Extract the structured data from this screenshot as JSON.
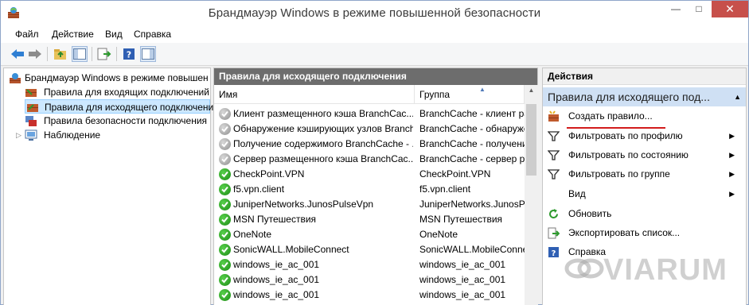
{
  "window": {
    "title": "Брандмауэр Windows в режиме повышенной безопасности"
  },
  "menu": [
    "Файл",
    "Действие",
    "Вид",
    "Справка"
  ],
  "tree": {
    "root": "Брандмауэр Windows в режиме повышен",
    "items": [
      "Правила для входящих подключений",
      "Правила для исходящего подключени",
      "Правила безопасности подключения",
      "Наблюдение"
    ]
  },
  "center": {
    "header": "Правила для исходящего подключения",
    "columns": {
      "name": "Имя",
      "group": "Группа"
    },
    "rows": [
      {
        "name": "Клиент размещенного кэша BranchCac...",
        "group": "BranchCache - клиент ра",
        "enabled": false
      },
      {
        "name": "Обнаружение кэширующих узлов Branch...",
        "group": "BranchCache - обнаруже",
        "enabled": false
      },
      {
        "name": "Получение содержимого BranchCache - ...",
        "group": "BranchCache - получени",
        "enabled": false
      },
      {
        "name": "Сервер размещенного кэша BranchCac...",
        "group": "BranchCache - сервер ра",
        "enabled": false
      },
      {
        "name": "CheckPoint.VPN",
        "group": "CheckPoint.VPN",
        "enabled": true
      },
      {
        "name": "f5.vpn.client",
        "group": "f5.vpn.client",
        "enabled": true
      },
      {
        "name": "JuniperNetworks.JunosPulseVpn",
        "group": "JuniperNetworks.JunosPu",
        "enabled": true
      },
      {
        "name": "MSN Путешествия",
        "group": "MSN Путешествия",
        "enabled": true
      },
      {
        "name": "OneNote",
        "group": "OneNote",
        "enabled": true
      },
      {
        "name": "SonicWALL.MobileConnect",
        "group": "SonicWALL.MobileConnect",
        "enabled": true
      },
      {
        "name": "windows_ie_ac_001",
        "group": "windows_ie_ac_001",
        "enabled": true
      },
      {
        "name": "windows_ie_ac_001",
        "group": "windows_ie_ac_001",
        "enabled": true
      },
      {
        "name": "windows_ie_ac_001",
        "group": "windows_ie_ac_001",
        "enabled": true
      }
    ]
  },
  "actions": {
    "header": "Действия",
    "section": "Правила для исходящего под...",
    "items": [
      {
        "label": "Создать правило...",
        "icon": "new-rule-icon",
        "submenu": false
      },
      {
        "label": "Фильтровать по профилю",
        "icon": "filter-icon",
        "submenu": true
      },
      {
        "label": "Фильтровать по состоянию",
        "icon": "filter-icon",
        "submenu": true
      },
      {
        "label": "Фильтровать по группе",
        "icon": "filter-icon",
        "submenu": true
      },
      {
        "label": "Вид",
        "icon": "",
        "submenu": true
      },
      {
        "label": "Обновить",
        "icon": "refresh-icon",
        "submenu": false
      },
      {
        "label": "Экспортировать список...",
        "icon": "export-icon",
        "submenu": false
      },
      {
        "label": "Справка",
        "icon": "help-icon",
        "submenu": false
      }
    ]
  },
  "watermark": "VIARUM",
  "colors": {
    "selection": "#cce8ff",
    "section": "#cfe0f4",
    "header": "#6d6d6d",
    "underline": "#d21c1c"
  }
}
